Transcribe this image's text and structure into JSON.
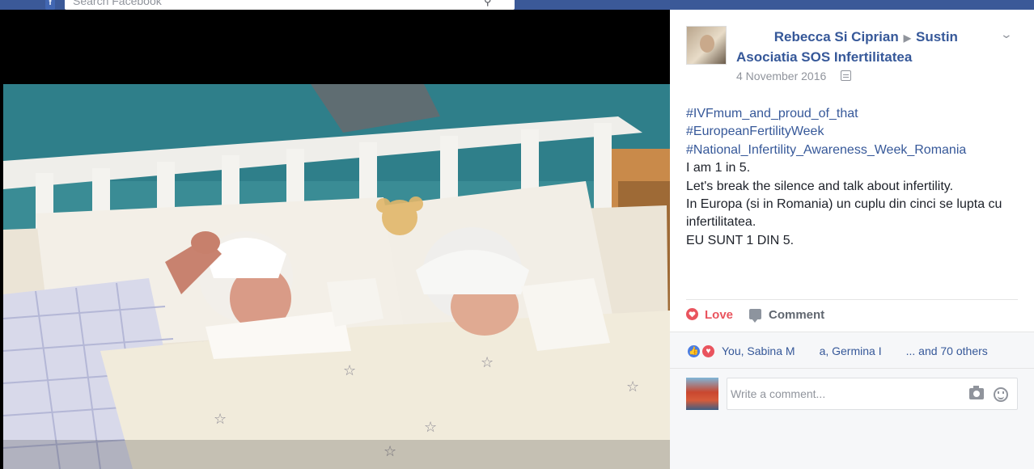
{
  "topbar": {
    "search_placeholder": "Search Facebook"
  },
  "post": {
    "author_name": "Rebecca Si Ciprian",
    "target_name": "Sustin Asociatia SOS Infertilitatea",
    "date": "4 November 2016",
    "text_lines": [
      {
        "text": "#IVFmum_and_proud_of_that",
        "kind": "hashtag"
      },
      {
        "text": "#EuropeanFertilityWeek",
        "kind": "hashtag"
      },
      {
        "text": "#National_Infertility_Awareness_Week_Romania",
        "kind": "hashtag"
      },
      {
        "text": "I am 1 in 5.",
        "kind": "plain"
      },
      {
        "text": "Let's break the silence and talk about infertility.",
        "kind": "plain"
      },
      {
        "text": "In Europa (si in Romania) un cuplu din cinci se lupta cu infertilitatea.",
        "kind": "plain"
      },
      {
        "text": "EU SUNT 1 DIN 5.",
        "kind": "plain"
      }
    ]
  },
  "actions": {
    "love_label": "Love",
    "comment_label": "Comment"
  },
  "reactions": {
    "part1": "You, Sabina M",
    "part2": "a, Germina I",
    "part3": "... and 70 others"
  },
  "comment_box": {
    "placeholder": "Write a comment..."
  },
  "colors": {
    "link": "#365899",
    "love": "#e9545e",
    "facebook_blue": "#3b5998"
  }
}
